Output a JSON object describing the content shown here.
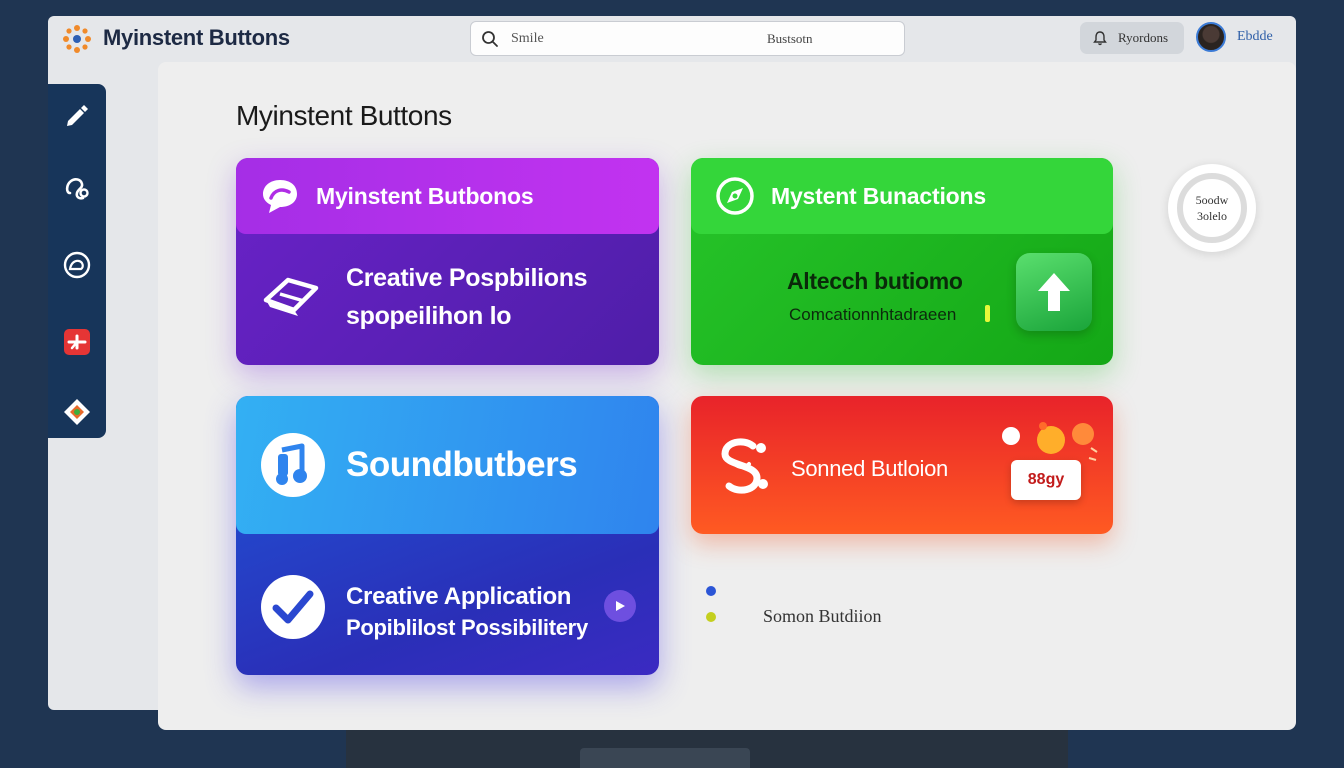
{
  "header": {
    "app_title": "Myinstent Buttons",
    "logo_icon": "sunburst-logo-icon",
    "search": {
      "placeholder": "Smile",
      "right_text": "Bustsotn"
    },
    "notifications_label": "Ryordons",
    "user_name": "Ebdde"
  },
  "sidebar": {
    "items": [
      {
        "icon": "pencil-icon"
      },
      {
        "icon": "headphone-icon"
      },
      {
        "icon": "chat-bubble-icon"
      },
      {
        "icon": "add-box-icon"
      },
      {
        "icon": "tag-icon"
      }
    ]
  },
  "main": {
    "page_title": "Myinstent Buttons",
    "cards": {
      "purple": {
        "header_label": "Myinstent Butbonos",
        "header_icon": "speech-bubble-icon",
        "body_icon": "eraser-icon",
        "line1": "Creative Pospbilions",
        "line2": "spopeilihon lo"
      },
      "green": {
        "header_label": "Mystent Bunactions",
        "header_icon": "compass-icon",
        "line1": "Altecch butiomo",
        "line2": "Comcationnhtadraeen",
        "action_icon": "arrow-up-icon"
      },
      "blue": {
        "header_label": "Soundbutbers",
        "header_icon": "music-note-icon",
        "body_icon": "check-icon",
        "line1": "Creative Application",
        "line2": "Popiblilost Possibilitery",
        "mini_icon": "play-icon"
      },
      "red": {
        "label": "Sonned Butloion",
        "icon": "sound-wave-icon",
        "badge": "88gy"
      }
    },
    "legend": {
      "label": "Somon Butdiion",
      "colors": [
        "#2b55d6",
        "#c4cf1e"
      ]
    },
    "ring_widget": {
      "line1": "5oodw",
      "line2": "3olelo"
    }
  },
  "colors": {
    "background": "#1f3552",
    "sidebar": "#17355a",
    "purple": "#6a22c8",
    "green": "#27c52a",
    "blue": "#1f56d8",
    "red": "#e8232a"
  }
}
